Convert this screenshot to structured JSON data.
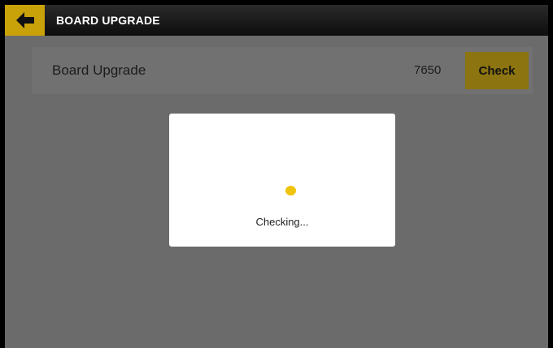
{
  "header": {
    "title": "BOARD UPGRADE",
    "back_icon": "arrow-left-icon"
  },
  "row": {
    "label": "Board Upgrade",
    "value": "7650",
    "button_label": "Check"
  },
  "dialog": {
    "message": "Checking...",
    "spinner_icon": "loading-spinner-icon"
  },
  "colors": {
    "accent": "#f0c40d",
    "accent_dimmed": "#8c7410",
    "overlay_background": "#6b6b6b",
    "topbar": "#111111"
  }
}
